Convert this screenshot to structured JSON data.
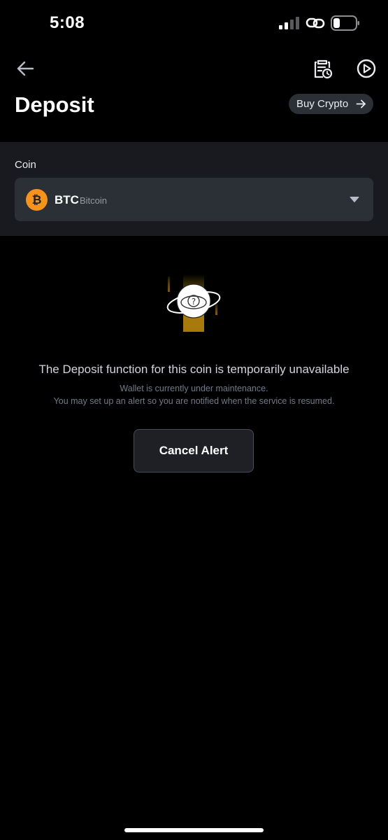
{
  "status_bar": {
    "time": "5:08",
    "battery_level": 0.3
  },
  "header": {
    "title": "Deposit",
    "buy_crypto_label": "Buy Crypto"
  },
  "coin": {
    "label": "Coin",
    "symbol": "BTC",
    "name": "Bitcoin",
    "icon_glyph": "₿",
    "icon_color": "#f7931a"
  },
  "message": {
    "title": "The Deposit function for this coin is temporarily unavailable",
    "line1": "Wallet is currently under maintenance.",
    "line2": "You may set up an alert so you are notified when the service is resumed."
  },
  "actions": {
    "cancel_alert_label": "Cancel Alert"
  },
  "icons": {
    "back": "arrow-left-icon",
    "history": "clipboard-clock-icon",
    "play": "play-circle-icon",
    "buy_arrow": "arrow-right-icon",
    "caret": "caret-down-icon",
    "illustration": "question-planet-icon"
  },
  "colors": {
    "background": "#000000",
    "panel": "#181a20",
    "field": "#2b2f36",
    "accent": "#f0b90b"
  }
}
